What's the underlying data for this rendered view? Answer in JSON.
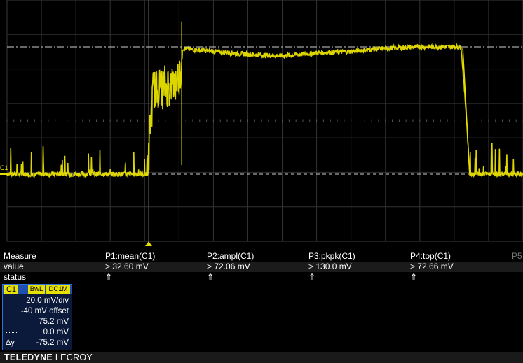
{
  "scope": {
    "channel_label": "C1",
    "trace_color": "#e8e000"
  },
  "chart_data": {
    "type": "line",
    "series": [
      {
        "name": "C1",
        "description_points": [
          [
            0.0,
            0.0
          ],
          [
            4.1,
            0.0
          ],
          [
            4.15,
            15.0
          ],
          [
            4.25,
            28.0
          ],
          [
            4.5,
            29.0
          ],
          [
            4.9,
            30.0
          ],
          [
            5.05,
            35.0
          ],
          [
            5.1,
            42.0
          ],
          [
            5.4,
            41.5
          ],
          [
            6.0,
            41.0
          ],
          [
            7.0,
            40.0
          ],
          [
            8.0,
            39.5
          ],
          [
            9.0,
            40.5
          ],
          [
            10.0,
            41.0
          ],
          [
            11.0,
            42.0
          ],
          [
            12.0,
            42.5
          ],
          [
            13.2,
            42.5
          ],
          [
            13.35,
            20.0
          ],
          [
            13.45,
            0.0
          ],
          [
            15.0,
            0.0
          ]
        ]
      }
    ],
    "x_divisions": 15,
    "y_divisions": 7,
    "grid": true
  },
  "measure": {
    "header": "Measure",
    "row_value": "value",
    "row_status": "status",
    "columns": [
      {
        "label": "P1:mean(C1)",
        "value": "> 32.60 mV",
        "status": "⇑"
      },
      {
        "label": "P2:ampl(C1)",
        "value": "> 72.06 mV",
        "status": "⇑"
      },
      {
        "label": "P3:pkpk(C1)",
        "value": "> 130.0 mV",
        "status": "⇑"
      },
      {
        "label": "P4:top(C1)",
        "value": "> 72.66 mV",
        "status": "⇑"
      }
    ],
    "p5": "P5"
  },
  "channel": {
    "name": "C1",
    "bw": "BwL",
    "coupling": "DC1M",
    "vdiv": "20.0 mV/div",
    "offset": "-40 mV offset",
    "cursor1": "75.2 mV",
    "cursor2": "0.0 mV",
    "delta_label": "Δy",
    "delta": "-75.2 mV"
  },
  "footer": {
    "brand_bold": "TELEDYNE",
    "brand_light": "LECROY"
  }
}
